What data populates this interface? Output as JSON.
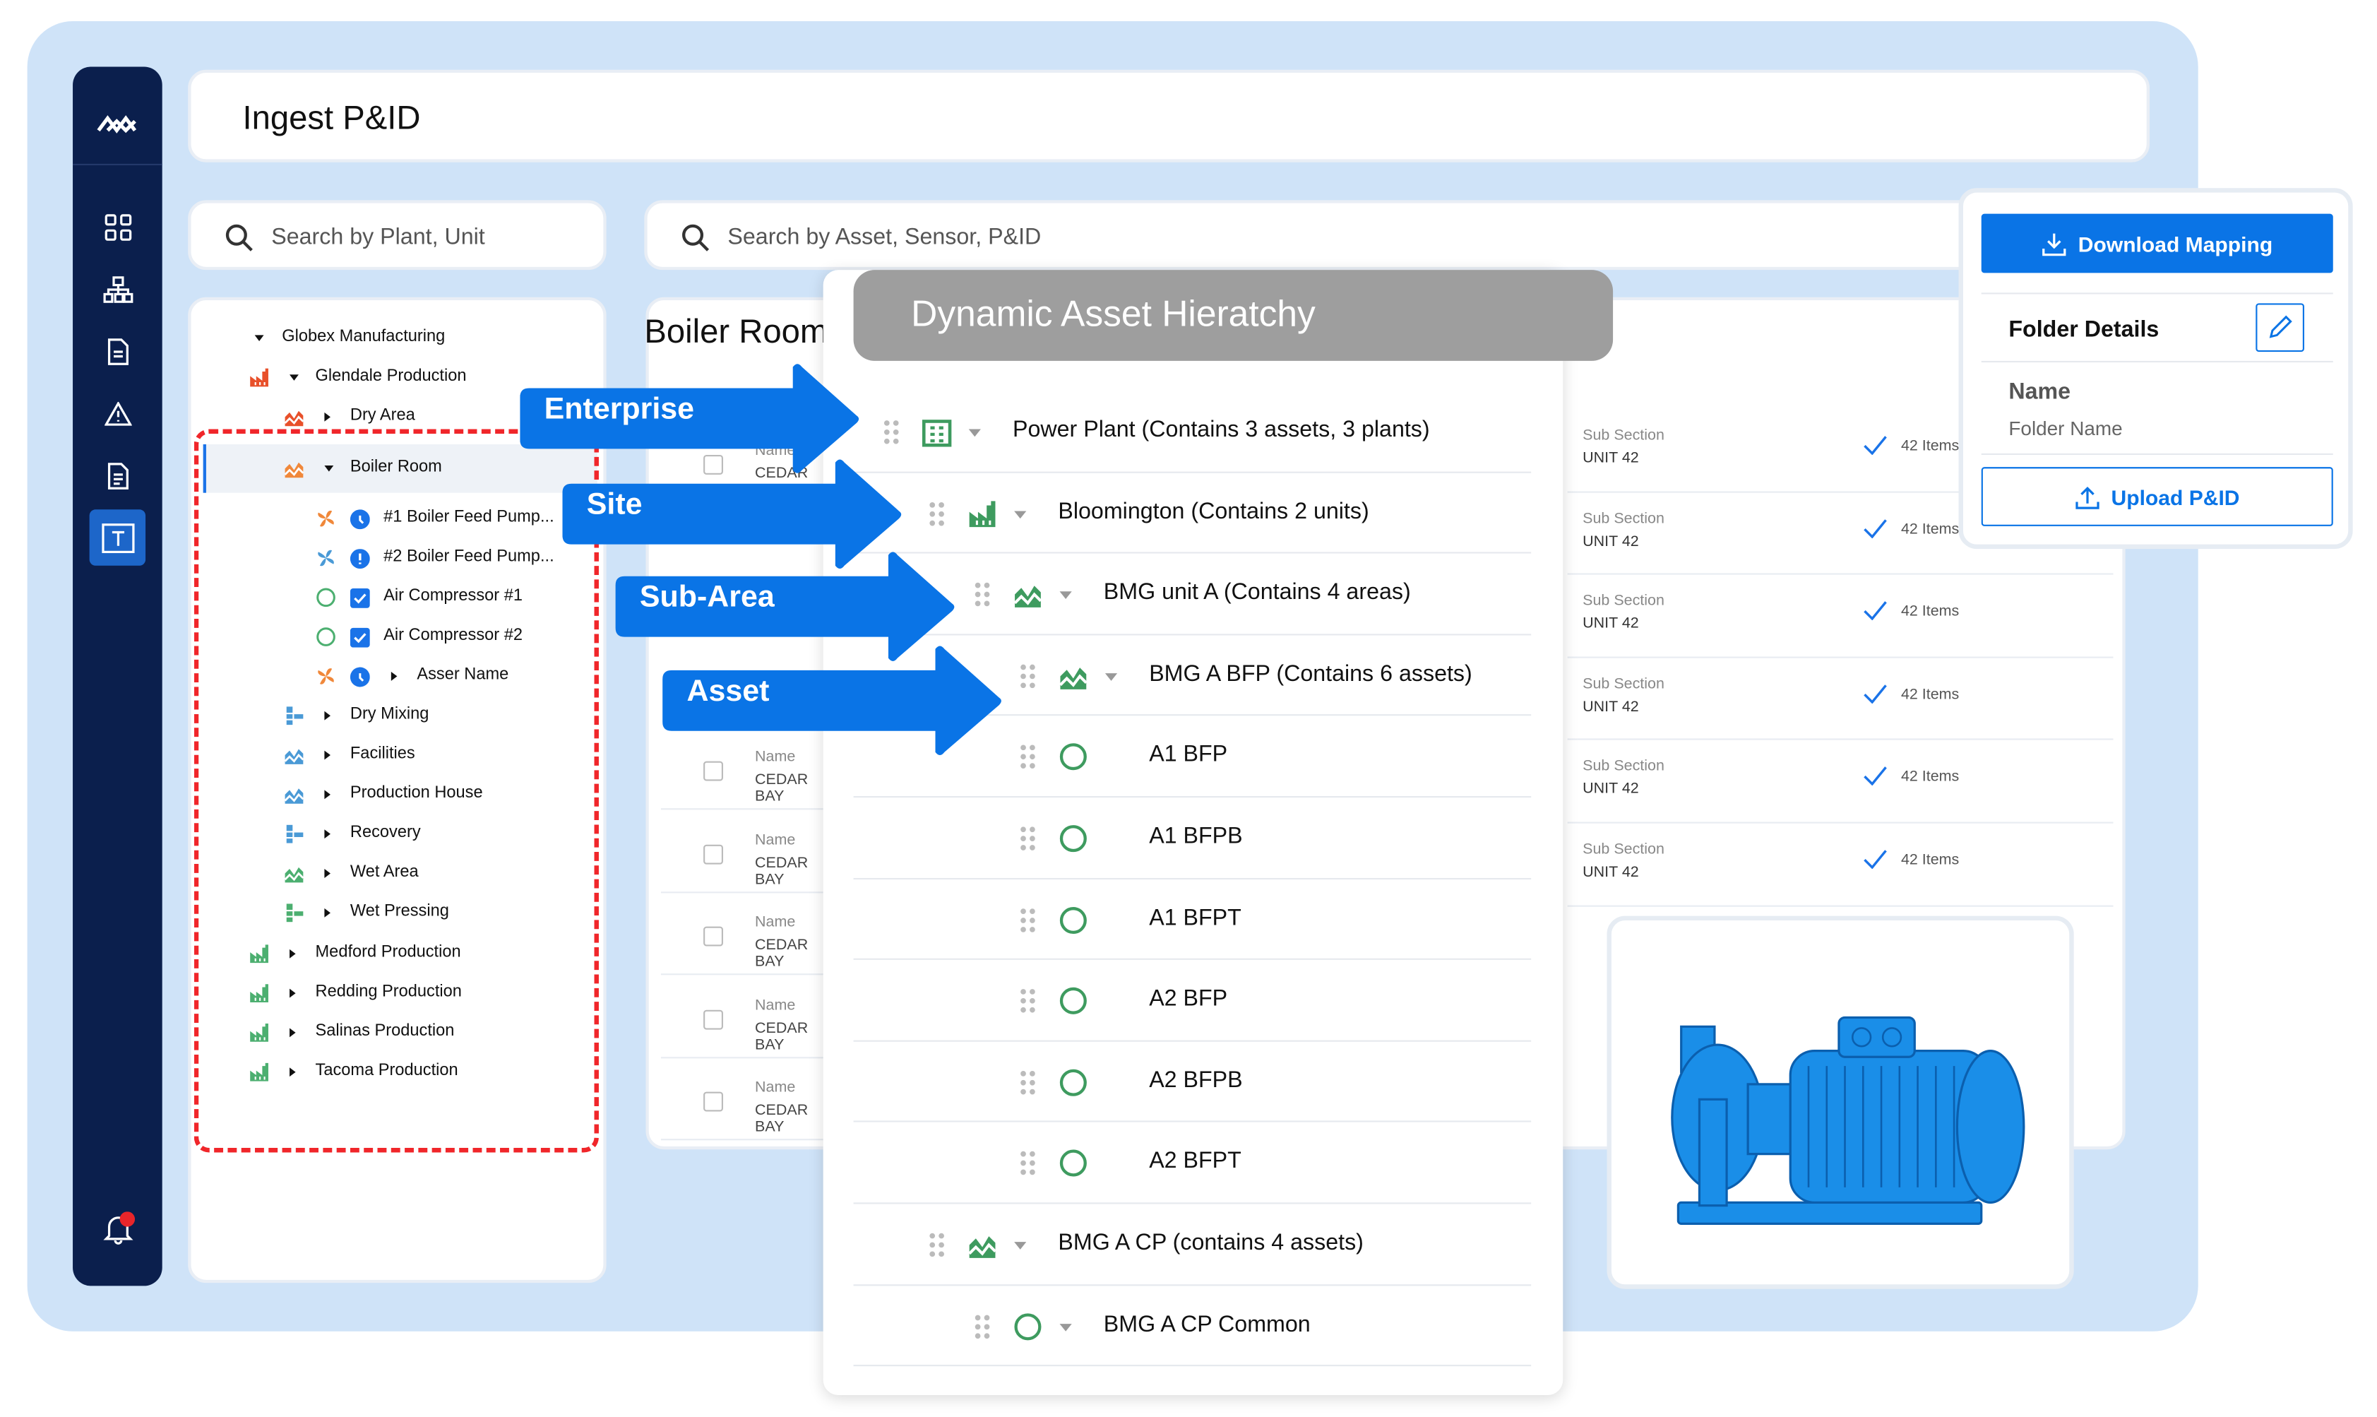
{
  "app": {
    "title": "Ingest P&ID",
    "accent": "#0a74e6",
    "sidebar_bg": "#0b1f4d",
    "backdrop": "#cfe3f8"
  },
  "sidebar": {
    "icons": [
      "logo-icon",
      "dashboard-icon",
      "hierarchy-icon",
      "document-icon",
      "warning-icon",
      "file-icon",
      "text-tool-icon",
      "bell-icon"
    ],
    "selected": "text-tool-icon",
    "notification": true
  },
  "search": {
    "plant_placeholder": "Search by Plant, Unit",
    "asset_placeholder": "Search by Asset, Sensor, P&ID"
  },
  "tree": {
    "items": [
      {
        "label": "Globex Manufacturing",
        "type": "enterprise",
        "expanded": true
      },
      {
        "label": "Glendale Production",
        "type": "plant",
        "color": "#e8502a",
        "expanded": true
      },
      {
        "label": "Dry Area",
        "type": "area",
        "color": "#e8502a",
        "expanded": false
      },
      {
        "label": "Boiler Room",
        "type": "area",
        "color": "#f0883a",
        "expanded": true,
        "selected": true
      },
      {
        "label": "#1 Boiler Feed Pump...",
        "type": "fan",
        "color": "#f0883a",
        "status": "clock"
      },
      {
        "label": "#2 Boiler Feed Pump...",
        "type": "fan",
        "color": "#4a9ad6",
        "status": "alert"
      },
      {
        "label": "Air Compressor #1",
        "type": "circle",
        "color": "#4caf70",
        "status": "checked"
      },
      {
        "label": "Air Compressor #2",
        "type": "circle",
        "color": "#4caf70",
        "status": "checked"
      },
      {
        "label": "Asser Name",
        "type": "fan",
        "color": "#f0883a",
        "status": "clock",
        "expanded": false
      },
      {
        "label": "Dry Mixing",
        "type": "process",
        "color": "#4a9ad6"
      },
      {
        "label": "Facilities",
        "type": "area",
        "color": "#4a9ad6"
      },
      {
        "label": "Production House",
        "type": "area",
        "color": "#4a9ad6"
      },
      {
        "label": "Recovery",
        "type": "process",
        "color": "#4a9ad6"
      },
      {
        "label": "Wet Area",
        "type": "area",
        "color": "#4caf70"
      },
      {
        "label": "Wet Pressing",
        "type": "process",
        "color": "#4caf70"
      },
      {
        "label": "Medford Production",
        "type": "plant",
        "color": "#4caf70"
      },
      {
        "label": "Redding Production",
        "type": "plant",
        "color": "#4caf70"
      },
      {
        "label": "Salinas Production",
        "type": "plant",
        "color": "#4caf70"
      },
      {
        "label": "Tacoma Production",
        "type": "plant",
        "color": "#4caf70"
      }
    ]
  },
  "main": {
    "heading": "Boiler Room",
    "left_rows": [
      {
        "name": "Name",
        "value": "CEDAR"
      },
      {
        "name": "Name",
        "value": "CEDAR BAY"
      },
      {
        "name": "Name",
        "value": "CEDAR BAY"
      },
      {
        "name": "Name",
        "value": "CEDAR BAY"
      },
      {
        "name": "Name",
        "value": "CEDAR BAY"
      },
      {
        "name": "Name",
        "value": "CEDAR BAY"
      }
    ],
    "right_rows": [
      {
        "label": "Sub Section",
        "value": "UNIT 42",
        "count": "42 Items"
      },
      {
        "label": "Sub Section",
        "value": "UNIT 42",
        "count": "42 Items"
      },
      {
        "label": "Sub Section",
        "value": "UNIT 42",
        "count": "42 Items"
      },
      {
        "label": "Sub Section",
        "value": "UNIT 42",
        "count": "42 Items"
      },
      {
        "label": "Sub Section",
        "value": "UNIT 42",
        "count": "42 Items"
      },
      {
        "label": "Sub Section",
        "value": "UNIT 42",
        "count": "42 Items"
      }
    ]
  },
  "hierarchy": {
    "title": "Dynamic Asset Hieratchy",
    "rows": [
      {
        "label": "Power Plant (Contains 3 assets, 3 plants)",
        "level": 0,
        "icon": "building",
        "caret": true
      },
      {
        "label": "Bloomington (Contains 2 units)",
        "level": 1,
        "icon": "plant",
        "caret": true
      },
      {
        "label": "BMG unit A (Contains 4 areas)",
        "level": 2,
        "icon": "area",
        "caret": true
      },
      {
        "label": "BMG A BFP (Contains 6 assets)",
        "level": 3,
        "icon": "area",
        "caret": true
      },
      {
        "label": "A1 BFP",
        "level": 3,
        "icon": "circle",
        "caret": false
      },
      {
        "label": "A1 BFPB",
        "level": 3,
        "icon": "circle",
        "caret": false
      },
      {
        "label": "A1 BFPT",
        "level": 3,
        "icon": "circle",
        "caret": false
      },
      {
        "label": "A2 BFP",
        "level": 3,
        "icon": "circle",
        "caret": false
      },
      {
        "label": "A2 BFPB",
        "level": 3,
        "icon": "circle",
        "caret": false
      },
      {
        "label": "A2 BFPT",
        "level": 3,
        "icon": "circle",
        "caret": false
      },
      {
        "label": "BMG A CP (contains 4 assets)",
        "level": 1,
        "icon": "area",
        "caret": true
      },
      {
        "label": "BMG A CP Common",
        "level": 2,
        "icon": "circle",
        "caret": true
      }
    ]
  },
  "callouts": [
    "Enterprise",
    "Site",
    "Sub-Area",
    "Asset"
  ],
  "folder": {
    "download_label": "Download Mapping",
    "section_title": "Folder Details",
    "name_label": "Name",
    "name_value": "Folder Name",
    "upload_label": "Upload P&ID"
  }
}
